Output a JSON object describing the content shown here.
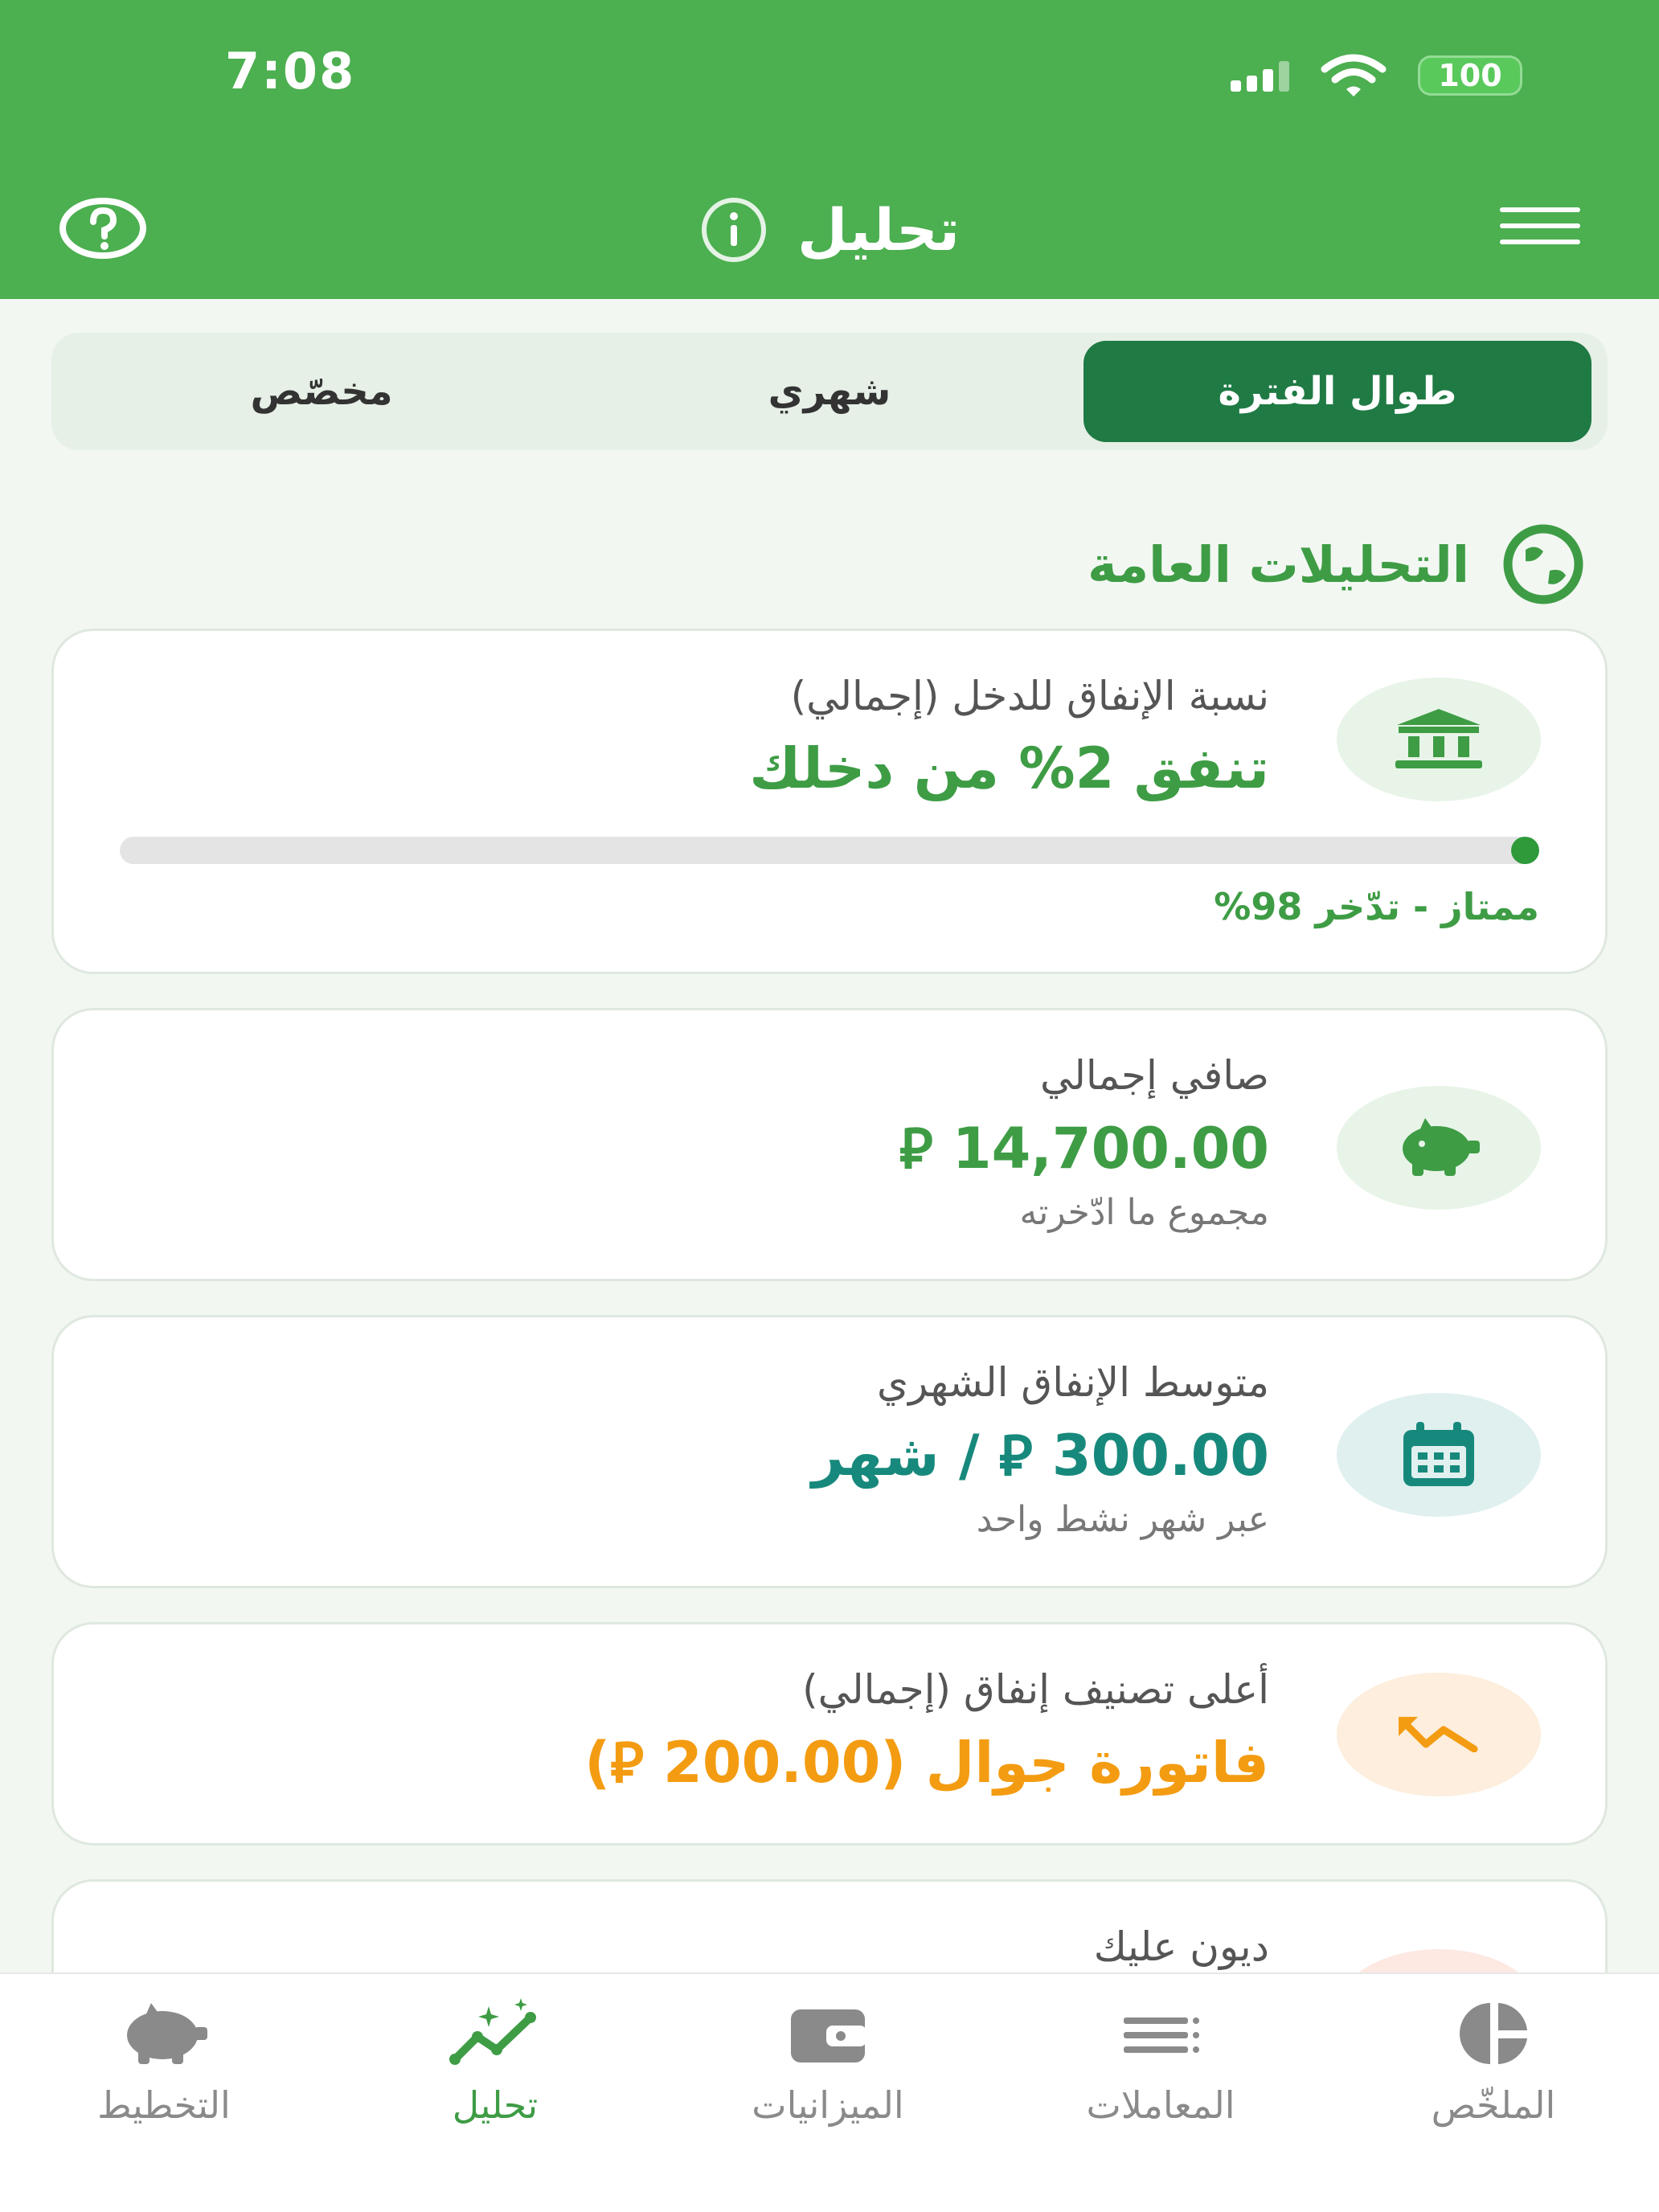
{
  "status_bar": {
    "time": "7:08",
    "battery": "100"
  },
  "header": {
    "title": "تحليل",
    "icons": [
      "help-icon",
      "info-icon",
      "menu-icon"
    ]
  },
  "period_tabs": {
    "selected": "طوال الفترة",
    "tabs": [
      "طوال الفترة",
      "شهري",
      "مخصّص"
    ]
  },
  "section": {
    "title": "التحليلات العامة",
    "icon": "globe-icon"
  },
  "cards": [
    {
      "label": "نسبة الإنفاق للدخل (إجمالي)",
      "value": "تنفق 2% من دخلك",
      "progress_percent": 2,
      "note": "ممتاز - تدّخر 98%",
      "icon": "bank-icon"
    },
    {
      "label": "صافي إجمالي",
      "value": "14,700.00 ⃁",
      "sub": "مجموع ما ادّخرته",
      "icon": "piggy-bank-icon"
    },
    {
      "label": "متوسط الإنفاق الشهري",
      "value": "300.00 ⃁ / شهر",
      "sub": "عبر شهر نشط واحد",
      "icon": "calendar-icon"
    },
    {
      "label": "أعلى تصنيف إنفاق (إجمالي)",
      "value": "فاتورة جوال (200.00 ⃁)",
      "icon": "trend-icon"
    },
    {
      "label": "ديون عليك",
      "icon": "debt-icon"
    }
  ],
  "colors": {
    "primary": "#4caf50",
    "dark_green": "#1f7a44",
    "green_text": "#3e9c45",
    "teal": "#17897c",
    "orange": "#f39c12"
  },
  "bottom_nav": [
    {
      "label": "الملخّص",
      "icon": "pie-chart-icon"
    },
    {
      "label": "المعاملات",
      "icon": "list-icon"
    },
    {
      "label": "الميزانيات",
      "icon": "wallet-icon"
    },
    {
      "label": "تحليل",
      "icon": "analytics-icon",
      "active": true
    },
    {
      "label": "التخطيط",
      "icon": "piggy-bank-icon"
    }
  ]
}
